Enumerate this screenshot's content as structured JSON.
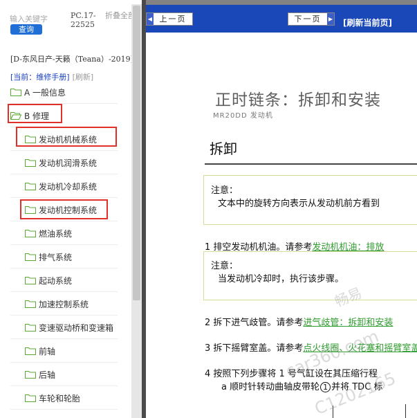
{
  "sidebar": {
    "search_placeholder": "输入关键字",
    "search_button": "查询",
    "pc_code": "PC.17-22525",
    "fold_all": "折叠全部",
    "model": "[D-东风日产-天籁（Teana）-2019]",
    "current_label": "[当前：维修手册]",
    "refresh_label": "[刷新]",
    "tree": [
      {
        "label": "A 一般信息",
        "level": 0
      },
      {
        "label": "B 修理",
        "level": 0,
        "open": true
      },
      {
        "label": "发动机机械系统",
        "level": 1
      },
      {
        "label": "发动机润滑系统",
        "level": 1
      },
      {
        "label": "发动机冷却系统",
        "level": 1
      },
      {
        "label": "发动机控制系统",
        "level": 1
      },
      {
        "label": "燃油系统",
        "level": 1
      },
      {
        "label": "排气系统",
        "level": 1
      },
      {
        "label": "起动系统",
        "level": 1
      },
      {
        "label": "加速控制系统",
        "level": 1
      },
      {
        "label": "变速驱动桥和变速箱",
        "level": 1
      },
      {
        "label": "前轴",
        "level": 1
      },
      {
        "label": "后轴",
        "level": 1
      },
      {
        "label": "车轮和轮胎",
        "level": 1
      }
    ]
  },
  "toolbar": {
    "prev_label": "上一页",
    "next_label": "下一页",
    "refresh_page": "[刷新当前页]"
  },
  "document": {
    "title": "正时链条：拆卸和安装",
    "subtitle": "MR20DD 发动机",
    "section": "拆卸",
    "notice1_title": "注意：",
    "notice1_text": "文本中的旋转方向表示从发动机前方看到",
    "step1_text": "1 排空发动机机油。请参考",
    "step1_link": "发动机机油：排放",
    "notice2_title": "注意：",
    "notice2_text": "当发动机冷却时，执行该步骤。",
    "step2_text": "2 拆下进气歧管。请参考",
    "step2_link": "进气歧管：拆卸和安装",
    "step3_text": "3 拆下摇臂室盖。请参考",
    "step3_link": "点火线圈、火花塞和摇臂室盖",
    "step4_text": "4 按照下列步骤将 1 号气缸设在其压缩行程",
    "step4a_text": "a 顺时针转动曲轴皮带轮",
    "step4a_circle": "1",
    "step4a_tail": "并将 TDC 标"
  },
  "watermark": {
    "line1": "畅易",
    "line2": "car360.com",
    "line3": "C1202165"
  },
  "colors": {
    "header_blue": "#1a48b8",
    "link_green": "#2e9b2e",
    "highlight_red": "#e0302a",
    "search_blue": "#1f6fd6"
  }
}
